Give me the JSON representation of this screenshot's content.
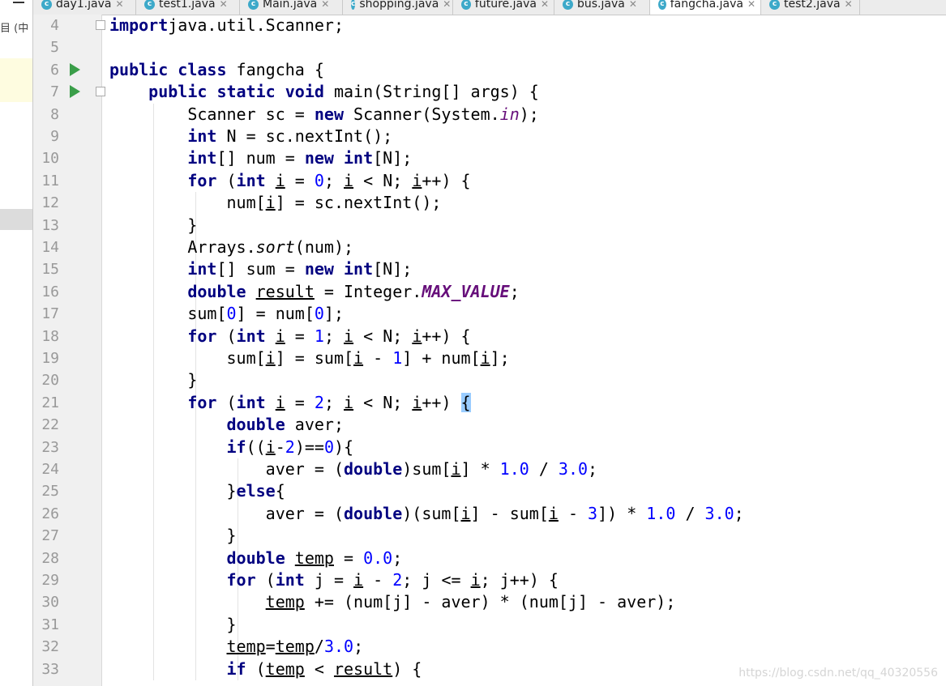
{
  "sidebar": {
    "partial_text": "目 (中"
  },
  "tabs": [
    {
      "label": "day1.java",
      "active": false,
      "icon": "class-c-icon"
    },
    {
      "label": "test1.java",
      "active": false,
      "icon": "class-c-icon"
    },
    {
      "label": "Main.java",
      "active": false,
      "icon": "class-c-icon"
    },
    {
      "label": "shopping.java",
      "active": false,
      "icon": "class-c-icon"
    },
    {
      "label": "future.java",
      "active": false,
      "icon": "class-c-icon"
    },
    {
      "label": "bus.java",
      "active": false,
      "icon": "class-c-icon"
    },
    {
      "label": "fangcha.java",
      "active": true,
      "icon": "class-c-icon"
    },
    {
      "label": "test2.java",
      "active": false,
      "icon": "class-c-icon"
    }
  ],
  "gutter": {
    "line_numbers": [
      "4",
      "5",
      "6",
      "7",
      "8",
      "9",
      "10",
      "11",
      "12",
      "13",
      "14",
      "15",
      "16",
      "17",
      "18",
      "19",
      "20",
      "21",
      "22",
      "23",
      "24",
      "25",
      "26",
      "27",
      "28",
      "29",
      "30",
      "31",
      "32",
      "33"
    ],
    "run_markers_on_lines": [
      "6",
      "7"
    ],
    "fold_markers_on_lines": [
      "4",
      "7"
    ]
  },
  "code_lines": [
    [
      [
        "kw",
        "import"
      ],
      [
        "",
        "java.util.Scanner;"
      ]
    ],
    [],
    [
      [
        "kw",
        "public class "
      ],
      [
        "",
        "fangcha {"
      ]
    ],
    [
      [
        "",
        "    "
      ],
      [
        "kw",
        "public static void "
      ],
      [
        "",
        "main(String[] args) {"
      ]
    ],
    [
      [
        "",
        "        Scanner sc = "
      ],
      [
        "kw",
        "new "
      ],
      [
        "",
        "Scanner(System."
      ],
      [
        "sf",
        "in"
      ],
      [
        "",
        ");"
      ]
    ],
    [
      [
        "",
        "        "
      ],
      [
        "kw",
        "int "
      ],
      [
        "",
        "N = sc.nextInt();"
      ]
    ],
    [
      [
        "",
        "        "
      ],
      [
        "kw",
        "int"
      ],
      [
        "",
        "[] num = "
      ],
      [
        "kw",
        "new int"
      ],
      [
        "",
        "[N];"
      ]
    ],
    [
      [
        "",
        "        "
      ],
      [
        "kw",
        "for "
      ],
      [
        "",
        "("
      ],
      [
        "kw",
        "int "
      ],
      [
        "ul",
        "i"
      ],
      [
        "",
        " = "
      ],
      [
        "num",
        "0"
      ],
      [
        "",
        "; "
      ],
      [
        "ul",
        "i"
      ],
      [
        "",
        " < N; "
      ],
      [
        "ul",
        "i"
      ],
      [
        "",
        "++) {"
      ]
    ],
    [
      [
        "",
        "            num["
      ],
      [
        "ul",
        "i"
      ],
      [
        "",
        "] = sc.nextInt();"
      ]
    ],
    [
      [
        "",
        "        }"
      ]
    ],
    [
      [
        "",
        "        Arrays."
      ],
      [
        "it",
        "sort"
      ],
      [
        "",
        "(num);"
      ]
    ],
    [
      [
        "",
        "        "
      ],
      [
        "kw",
        "int"
      ],
      [
        "",
        "[] sum = "
      ],
      [
        "kw",
        "new int"
      ],
      [
        "",
        "[N];"
      ]
    ],
    [
      [
        "",
        "        "
      ],
      [
        "kw",
        "double "
      ],
      [
        "ul",
        "result"
      ],
      [
        "",
        " = Integer."
      ],
      [
        "sc",
        "MAX_VALUE"
      ],
      [
        "",
        ";"
      ]
    ],
    [
      [
        "",
        "        sum["
      ],
      [
        "num",
        "0"
      ],
      [
        "",
        "] = num["
      ],
      [
        "num",
        "0"
      ],
      [
        "",
        "];"
      ]
    ],
    [
      [
        "",
        "        "
      ],
      [
        "kw",
        "for "
      ],
      [
        "",
        "("
      ],
      [
        "kw",
        "int "
      ],
      [
        "ul",
        "i"
      ],
      [
        "",
        " = "
      ],
      [
        "num",
        "1"
      ],
      [
        "",
        "; "
      ],
      [
        "ul",
        "i"
      ],
      [
        "",
        " < N; "
      ],
      [
        "ul",
        "i"
      ],
      [
        "",
        "++) {"
      ]
    ],
    [
      [
        "",
        "            sum["
      ],
      [
        "ul",
        "i"
      ],
      [
        "",
        "] = sum["
      ],
      [
        "ul",
        "i"
      ],
      [
        "",
        " - "
      ],
      [
        "num",
        "1"
      ],
      [
        "",
        "] + num["
      ],
      [
        "ul",
        "i"
      ],
      [
        "",
        "];"
      ]
    ],
    [
      [
        "",
        "        }"
      ]
    ],
    [
      [
        "",
        "        "
      ],
      [
        "kw",
        "for "
      ],
      [
        "",
        "("
      ],
      [
        "kw",
        "int "
      ],
      [
        "ul",
        "i"
      ],
      [
        "",
        " = "
      ],
      [
        "num",
        "2"
      ],
      [
        "",
        "; "
      ],
      [
        "ul",
        "i"
      ],
      [
        "",
        " < N; "
      ],
      [
        "ul",
        "i"
      ],
      [
        "",
        "++) "
      ],
      [
        "br",
        "{"
      ]
    ],
    [
      [
        "",
        "            "
      ],
      [
        "kw",
        "double "
      ],
      [
        "",
        "aver;"
      ]
    ],
    [
      [
        "",
        "            "
      ],
      [
        "kw",
        "if"
      ],
      [
        "",
        "(("
      ],
      [
        "ul",
        "i"
      ],
      [
        "",
        "-"
      ],
      [
        "num",
        "2"
      ],
      [
        "",
        ")=="
      ],
      [
        "num",
        "0"
      ],
      [
        "",
        "){"
      ]
    ],
    [
      [
        "",
        "                aver = ("
      ],
      [
        "kw",
        "double"
      ],
      [
        "",
        ")sum["
      ],
      [
        "ul",
        "i"
      ],
      [
        "",
        "] * "
      ],
      [
        "num",
        "1.0"
      ],
      [
        "",
        " / "
      ],
      [
        "num",
        "3.0"
      ],
      [
        "",
        ";"
      ]
    ],
    [
      [
        "",
        "            }"
      ],
      [
        "kw",
        "else"
      ],
      [
        "",
        "{"
      ]
    ],
    [
      [
        "",
        "                aver = ("
      ],
      [
        "kw",
        "double"
      ],
      [
        "",
        ")(sum["
      ],
      [
        "ul",
        "i"
      ],
      [
        "",
        "] - sum["
      ],
      [
        "ul",
        "i"
      ],
      [
        "",
        " - "
      ],
      [
        "num",
        "3"
      ],
      [
        "",
        "]) * "
      ],
      [
        "num",
        "1.0"
      ],
      [
        "",
        " / "
      ],
      [
        "num",
        "3.0"
      ],
      [
        "",
        ";"
      ]
    ],
    [
      [
        "",
        "            }"
      ]
    ],
    [
      [
        "",
        "            "
      ],
      [
        "kw",
        "double "
      ],
      [
        "ul",
        "temp"
      ],
      [
        "",
        " = "
      ],
      [
        "num",
        "0.0"
      ],
      [
        "",
        ";"
      ]
    ],
    [
      [
        "",
        "            "
      ],
      [
        "kw",
        "for "
      ],
      [
        "",
        "("
      ],
      [
        "kw",
        "int "
      ],
      [
        "",
        "j = "
      ],
      [
        "ul",
        "i"
      ],
      [
        "",
        " - "
      ],
      [
        "num",
        "2"
      ],
      [
        "",
        "; j <= "
      ],
      [
        "ul",
        "i"
      ],
      [
        "",
        "; j++) {"
      ]
    ],
    [
      [
        "",
        "                "
      ],
      [
        "ul",
        "temp"
      ],
      [
        "",
        " += (num[j] - aver) * (num[j] - aver);"
      ]
    ],
    [
      [
        "",
        "            }"
      ]
    ],
    [
      [
        "",
        "            "
      ],
      [
        "ul",
        "temp"
      ],
      [
        "",
        "="
      ],
      [
        "ul",
        "temp"
      ],
      [
        "",
        "/"
      ],
      [
        "num",
        "3.0"
      ],
      [
        "",
        ";"
      ]
    ],
    [
      [
        "",
        "            "
      ],
      [
        "kw",
        "if "
      ],
      [
        "",
        "("
      ],
      [
        "ul",
        "temp"
      ],
      [
        "",
        " < "
      ],
      [
        "ul",
        "result"
      ],
      [
        "",
        ") {"
      ]
    ]
  ],
  "watermark": "https://blog.csdn.net/qq_40320556",
  "colors": {
    "keyword": "#000080",
    "number": "#0000ff",
    "static_field": "#660e7a",
    "run_icon": "#3a9e49",
    "class_icon": "#3da9c9",
    "brace_highlight": "#99ccff"
  }
}
